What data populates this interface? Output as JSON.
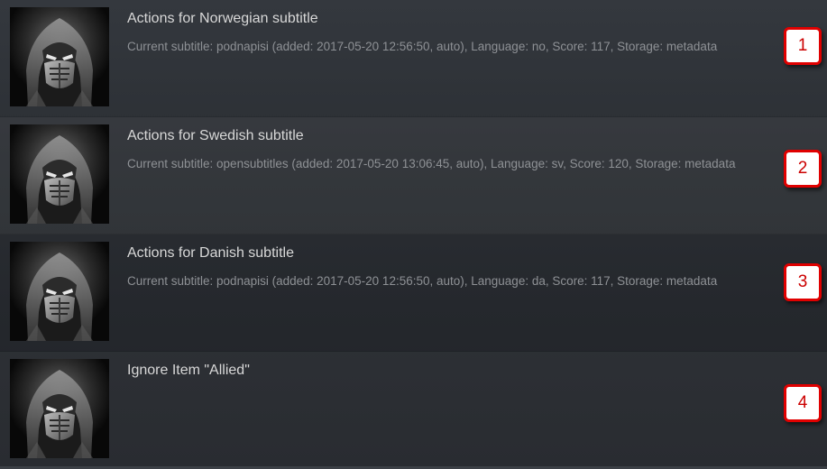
{
  "items": [
    {
      "title": "Actions for Norwegian subtitle",
      "info": "Current subtitle: podnapisi (added: 2017-05-20 12:56:50, auto), Language: no, Score: 117, Storage: metadata",
      "badge": "1",
      "thumbnail": "masked-ninja-poster-icon"
    },
    {
      "title": "Actions for Swedish subtitle",
      "info": "Current subtitle: opensubtitles (added: 2017-05-20 13:06:45, auto), Language: sv, Score: 120, Storage: metadata",
      "badge": "2",
      "thumbnail": "masked-ninja-poster-icon"
    },
    {
      "title": "Actions for Danish subtitle",
      "info": "Current subtitle: podnapisi (added: 2017-05-20 12:56:50, auto), Language: da, Score: 117, Storage: metadata",
      "badge": "3",
      "thumbnail": "masked-ninja-poster-icon"
    },
    {
      "title": "Ignore Item \"Allied\"",
      "info": "",
      "badge": "4",
      "thumbnail": "masked-ninja-poster-icon"
    }
  ],
  "colors": {
    "badge_border": "#e00000",
    "badge_text": "#cc0000",
    "title_text": "#d8d8d8",
    "info_text": "#8e9195"
  }
}
